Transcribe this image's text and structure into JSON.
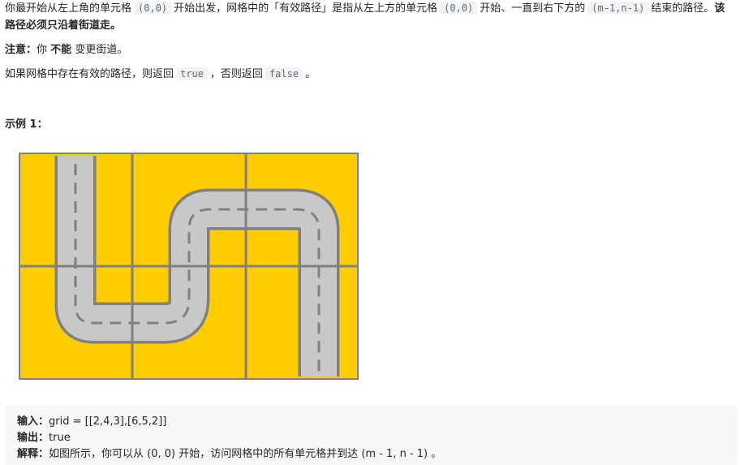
{
  "description": {
    "p1": {
      "a": "你最开始从左上角的单元格",
      "code1": "(0,0)",
      "b": "开始出发，网格中的「有效路径」是指从左上方的单元格",
      "code2": "(0,0)",
      "c": "开始、一直到右下方的",
      "code3": "(m-1,n-1)",
      "d": "结束的路径。",
      "bold": "该路径必须只沿着街道走。"
    },
    "p2": {
      "label": "注意：",
      "a": "你",
      "bold": "不能",
      "b": "变更街道。"
    },
    "p3": {
      "a": "如果网格中存在有效的路径，则返回",
      "code1": "true",
      "b": "，否则返回",
      "code2": "false",
      "c": "。"
    }
  },
  "example": {
    "title": "示例 1：",
    "input_label": "输入：",
    "input_value": "grid = [[2,4,3],[6,5,2]]",
    "output_label": "输出：",
    "output_value": "true",
    "explain_label": "解释：",
    "explain_value": "如图所示，你可以从 (0, 0) 开始，访问网格中的所有单元格并到达 (m - 1, n - 1) 。"
  },
  "figure": {
    "grid": [
      [
        2,
        4,
        3
      ],
      [
        6,
        5,
        2
      ]
    ],
    "colors": {
      "background": "#ffcc00",
      "street": "#c8c8c8",
      "border": "#808080",
      "dash": "#808080"
    }
  }
}
